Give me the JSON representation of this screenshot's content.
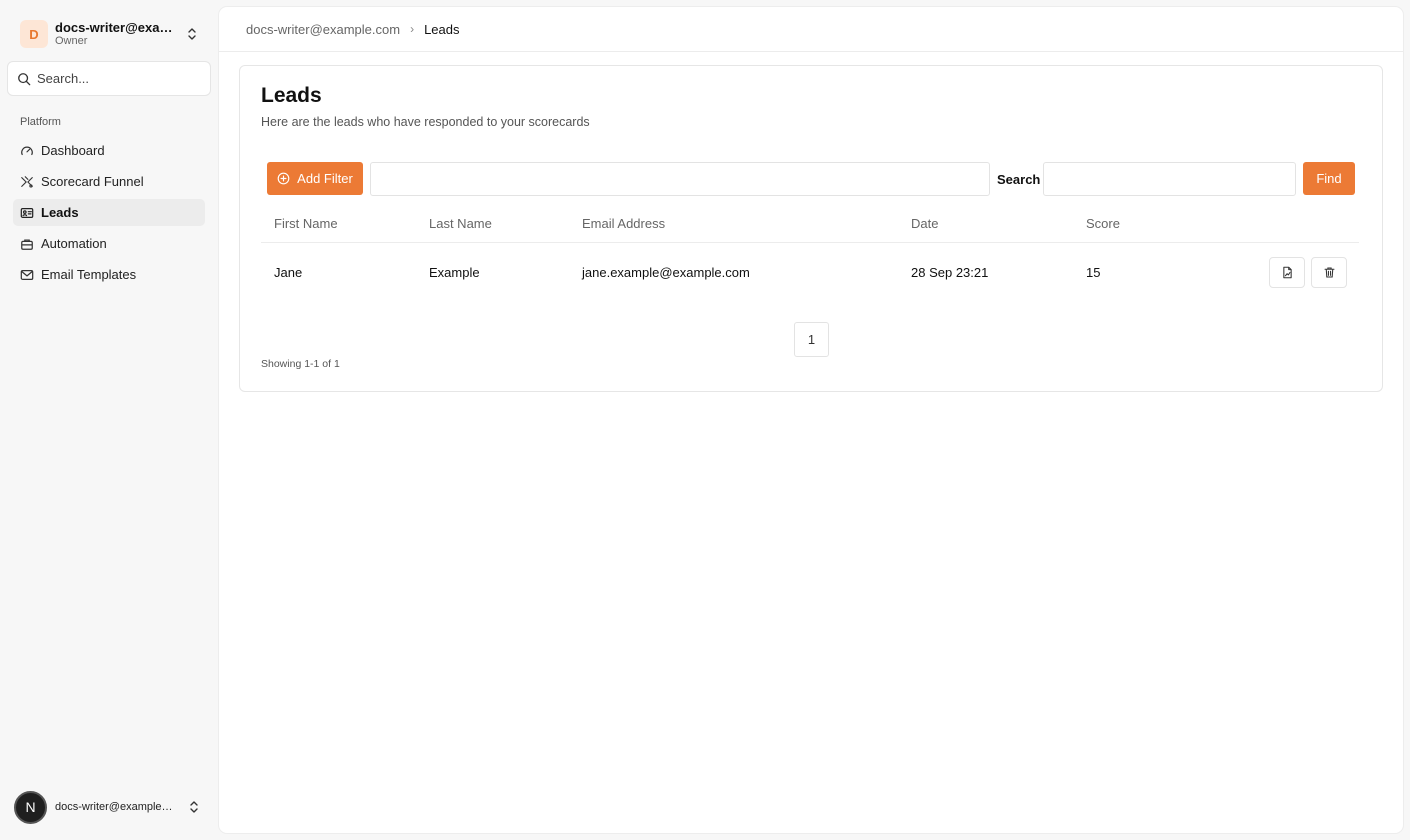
{
  "sidebar": {
    "org": {
      "initial": "D",
      "name": "docs-writer@example.com",
      "role": "Owner"
    },
    "search_placeholder": "Search...",
    "section_label": "Platform",
    "items": [
      {
        "label": "Dashboard",
        "icon": "gauge-icon"
      },
      {
        "label": "Scorecard Funnel",
        "icon": "funnel-icon"
      },
      {
        "label": "Leads",
        "icon": "id-card-icon",
        "active": true
      },
      {
        "label": "Automation",
        "icon": "briefcase-icon"
      },
      {
        "label": "Email Templates",
        "icon": "mail-icon"
      }
    ],
    "user": {
      "initial": "N",
      "email": "docs-writer@example.com"
    }
  },
  "breadcrumb": {
    "root": "docs-writer@example.com",
    "current": "Leads"
  },
  "page": {
    "title": "Leads",
    "subtitle": "Here are the leads who have responded to your scorecards"
  },
  "filters": {
    "add_filter_label": "Add Filter",
    "search_label": "Search",
    "find_label": "Find"
  },
  "table": {
    "columns": [
      "First Name",
      "Last Name",
      "Email Address",
      "Date",
      "Score"
    ],
    "rows": [
      {
        "first": "Jane",
        "last": "Example",
        "email": "jane.example@example.com",
        "date": "28 Sep 23:21",
        "score": "15"
      }
    ]
  },
  "pagination": {
    "current_page": "1",
    "showing": "Showing 1-1 of 1"
  },
  "colors": {
    "accent": "#ec7a35",
    "avatar_bg": "#fde6d6"
  }
}
